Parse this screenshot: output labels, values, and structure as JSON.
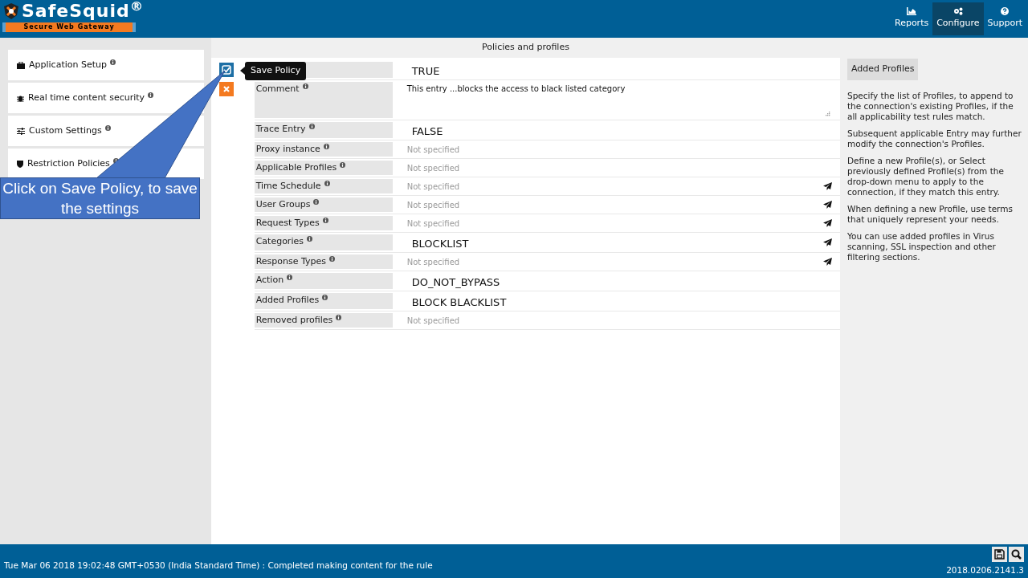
{
  "header": {
    "logo_title": "SafeSquid",
    "logo_mark": "®",
    "logo_subtitle": "Secure Web Gateway",
    "nav": [
      {
        "label": "Reports",
        "selected": false
      },
      {
        "label": "Configure",
        "selected": true
      },
      {
        "label": "Support",
        "selected": false
      }
    ]
  },
  "sidebar": {
    "items": [
      {
        "label": "Application Setup"
      },
      {
        "label": "Real time content security"
      },
      {
        "label": "Custom Settings"
      },
      {
        "label": "Restriction Policies"
      }
    ]
  },
  "page_title": "Policies and profiles",
  "actions": {
    "save_tooltip": "Save Policy"
  },
  "form": {
    "rows": [
      {
        "label": null,
        "kind": "value",
        "value": "TRUE",
        "picker": false
      },
      {
        "label": "Comment",
        "kind": "comment",
        "value": "This entry ...blocks the access to black listed category",
        "picker": false
      },
      {
        "label": "Trace Entry",
        "kind": "value",
        "value": "FALSE",
        "picker": false
      },
      {
        "label": "Proxy instance",
        "kind": "empty",
        "value": "Not specified",
        "picker": false
      },
      {
        "label": "Applicable Profiles",
        "kind": "empty",
        "value": "Not specified",
        "picker": false
      },
      {
        "label": "Time Schedule",
        "kind": "empty",
        "value": "Not specified",
        "picker": true
      },
      {
        "label": "User Groups",
        "kind": "empty",
        "value": "Not specified",
        "picker": true
      },
      {
        "label": "Request Types",
        "kind": "empty",
        "value": "Not specified",
        "picker": true
      },
      {
        "label": "Categories",
        "kind": "value",
        "value": "BLOCKLIST",
        "picker": true
      },
      {
        "label": "Response Types",
        "kind": "empty",
        "value": "Not specified",
        "picker": true
      },
      {
        "label": "Action",
        "kind": "value",
        "value": "DO_NOT_BYPASS",
        "picker": false
      },
      {
        "label": "Added Profiles",
        "kind": "value",
        "value": "BLOCK BLACKLIST",
        "picker": false
      },
      {
        "label": "Removed profiles",
        "kind": "empty",
        "value": "Not specified",
        "picker": false
      }
    ]
  },
  "help": {
    "title": "Added Profiles",
    "paragraphs": [
      "Specify the list of Profiles, to append to the connection's existing Profiles, if the all applicability test rules match.",
      "Subsequent applicable Entry may further modify the connection's Profiles.",
      "Define a new Profile(s), or Select previously defined Profile(s) from the drop-down menu to apply to the connection, if they match this entry.",
      "When defining a new Profile, use terms that uniquely represent your needs.",
      "You can use added profiles in Virus scanning, SSL inspection and other filtering sections."
    ]
  },
  "callout": "Click on Save Policy, to save the settings",
  "status_bar": {
    "message": "Tue Mar 06 2018 19:02:48 GMT+0530 (India Standard Time) : Completed making content for the rule",
    "version": "2018.0206.2141.3"
  }
}
